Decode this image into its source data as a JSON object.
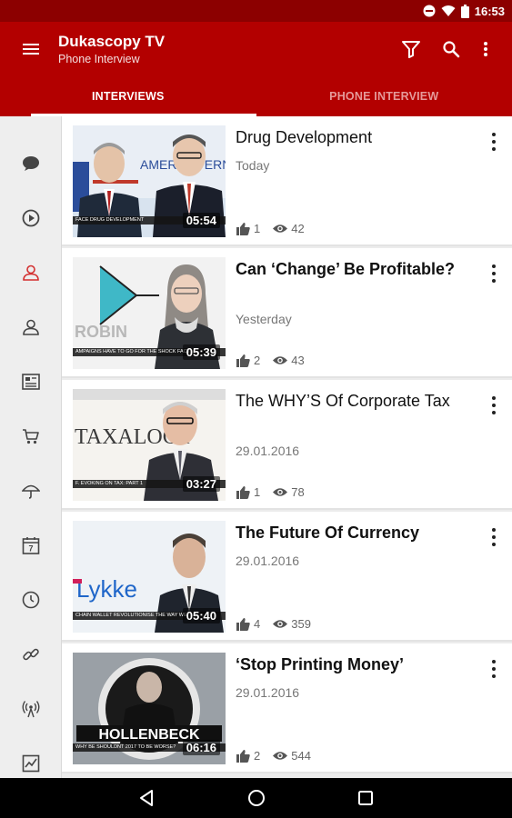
{
  "status_bar": {
    "time": "16:53",
    "icons": [
      "dnd-icon",
      "wifi-icon",
      "battery-icon"
    ]
  },
  "app_bar": {
    "title": "Dukascopy TV",
    "subtitle": "Phone Interview",
    "actions": [
      "filter-icon",
      "search-icon",
      "more-vert-icon"
    ]
  },
  "tabs": [
    {
      "label": "INTERVIEWS",
      "active": true
    },
    {
      "label": "PHONE INTERVIEW",
      "active": false
    }
  ],
  "side_rail": {
    "items": [
      "chat-icon",
      "play-icon",
      "person-icon",
      "person-outline-icon",
      "newspaper-icon",
      "cart-icon",
      "umbrella-icon",
      "calendar-icon",
      "clock-icon",
      "link-icon",
      "broadcast-icon",
      "chart-icon"
    ],
    "active_index": 2,
    "calendar_day": "7"
  },
  "videos": [
    {
      "title": "Drug Development",
      "date": "Today",
      "duration": "05:54",
      "likes": "1",
      "views": "42",
      "bold": false,
      "ticker": "FACE DRUG DEVELOPMENT",
      "thumb_text": "AMERI INTERN"
    },
    {
      "title": "Can ‘Change’ Be Profitable?",
      "date": "Yesterday",
      "duration": "05:39",
      "likes": "2",
      "views": "43",
      "bold": true,
      "ticker": "AMPAIGNS HAVE TO GO FOR THE SHOCK FACT",
      "thumb_text": "ROBIN"
    },
    {
      "title": "The WHY’S Of Corporate Tax",
      "date": "29.01.2016",
      "duration": "03:27",
      "likes": "1",
      "views": "78",
      "bold": false,
      "ticker": "F. EVOKING ON TAX: PART 1",
      "thumb_text": "TAXALOGY"
    },
    {
      "title": "The Future Of Currency",
      "date": "29.01.2016",
      "duration": "05:40",
      "likes": "4",
      "views": "359",
      "bold": true,
      "ticker": "CHAIN WALLET REVOLUTIONISE THE WAY WE",
      "thumb_text": "Lykke"
    },
    {
      "title": "‘Stop Printing Money’",
      "date": "29.01.2016",
      "duration": "06:16",
      "likes": "2",
      "views": "544",
      "bold": true,
      "ticker": "WHY BE SHOULDNT 2017 TO BE WORSE?",
      "thumb_text": "HOLLENBECK"
    }
  ],
  "nav_bar": {
    "buttons": [
      "back-icon",
      "home-icon",
      "recents-icon"
    ]
  },
  "colors": {
    "primary": "#b30000",
    "primary_dark": "#8c0000",
    "accent": "#d32f2f"
  }
}
